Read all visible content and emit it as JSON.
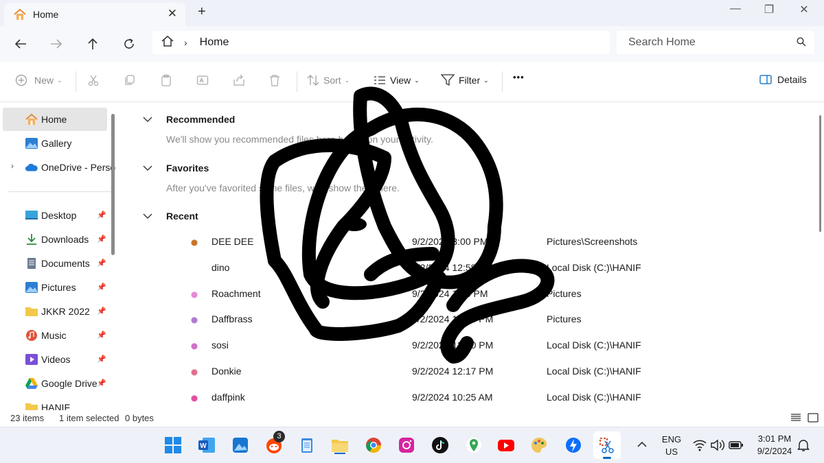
{
  "window": {
    "tab_title": "Home",
    "tab_close": "✕",
    "new_tab": "+",
    "minimize": "—",
    "restore": "❐",
    "close": "✕"
  },
  "nav": {
    "breadcrumb_chevron": "›",
    "path": "Home",
    "search_placeholder": "Search Home"
  },
  "toolbar": {
    "new_label": "New",
    "sort_label": "Sort",
    "view_label": "View",
    "filter_label": "Filter",
    "more_label": "•••",
    "details_label": "Details"
  },
  "sidebar": {
    "items": [
      {
        "label": "Home",
        "icon": "home-icon"
      },
      {
        "label": "Gallery",
        "icon": "gallery-icon"
      },
      {
        "label": "OneDrive - Perso",
        "icon": "cloud-icon"
      },
      {
        "label": "Desktop",
        "icon": "desktop-icon"
      },
      {
        "label": "Downloads",
        "icon": "download-icon"
      },
      {
        "label": "Documents",
        "icon": "document-icon"
      },
      {
        "label": "Pictures",
        "icon": "pictures-icon"
      },
      {
        "label": "JKKR 2022",
        "icon": "folder-icon"
      },
      {
        "label": "Music",
        "icon": "music-icon"
      },
      {
        "label": "Videos",
        "icon": "video-icon"
      },
      {
        "label": "Google Drive",
        "icon": "google-drive-icon"
      },
      {
        "label": "HANIF",
        "icon": "folder-icon"
      }
    ],
    "pin_glyph": "📌",
    "expand_glyph": "›"
  },
  "main": {
    "recommended": {
      "title": "Recommended",
      "hint": "We'll show you recommended files here based on your activity."
    },
    "favorites": {
      "title": "Favorites",
      "hint": "After you've favorited some files, we'll show them here."
    },
    "recent": {
      "title": "Recent",
      "files": [
        {
          "name": "DEE DEE",
          "date": "9/2/2024 3:00 PM",
          "location": "Pictures\\Screenshots",
          "color": "#c8742c"
        },
        {
          "name": "dino",
          "date": "9/2/2024 12:58 PM",
          "location": "Local Disk (C:)\\HANIF",
          "color": "#ffffff"
        },
        {
          "name": "Roachment",
          "date": "9/2/2024 1:16 PM",
          "location": "Pictures",
          "color": "#e58ad8"
        },
        {
          "name": "Daffbrass",
          "date": "9/2/2024 12:44 PM",
          "location": "Pictures",
          "color": "#b07ad0"
        },
        {
          "name": "sosi",
          "date": "9/2/2024 12:30 PM",
          "location": "Local Disk (C:)\\HANIF",
          "color": "#d070c8"
        },
        {
          "name": "Donkie",
          "date": "9/2/2024 12:17 PM",
          "location": "Local Disk (C:)\\HANIF",
          "color": "#e07090"
        },
        {
          "name": "daffpink",
          "date": "9/2/2024 10:25 AM",
          "location": "Local Disk (C:)\\HANIF",
          "color": "#e050a0"
        }
      ]
    }
  },
  "status": {
    "items_count": "23 items",
    "selected": "1 item selected",
    "size": "0 bytes"
  },
  "taskbar": {
    "reddit_badge": "3",
    "language": "ENG",
    "region": "US",
    "time": "3:01 PM",
    "date": "9/2/2024"
  },
  "colors": {
    "accent": "#0067c0",
    "scribble": "#000000",
    "folder": "#f2c94c"
  }
}
